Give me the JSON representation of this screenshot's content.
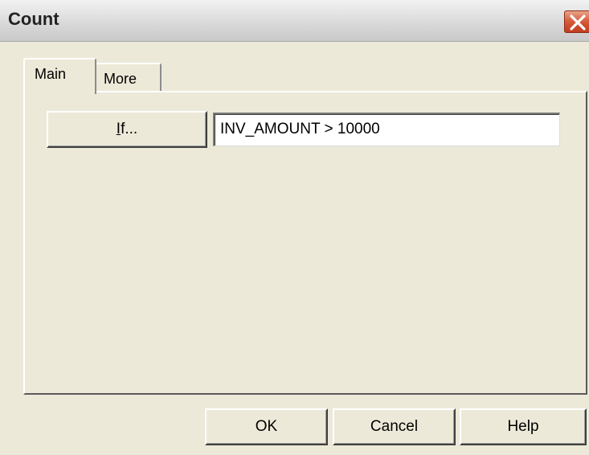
{
  "window": {
    "title": "Count",
    "close_icon": "close-icon",
    "accent": "#c23d20"
  },
  "tabs": [
    {
      "label": "Main",
      "selected": true
    },
    {
      "label": "More",
      "selected": false
    }
  ],
  "main": {
    "if_button": {
      "mnemonic": "I",
      "rest": "f..."
    },
    "if_expression": "INV_AMOUNT > 10000"
  },
  "footer": {
    "ok_label": "OK",
    "cancel_label": "Cancel",
    "help_label": "Help"
  }
}
